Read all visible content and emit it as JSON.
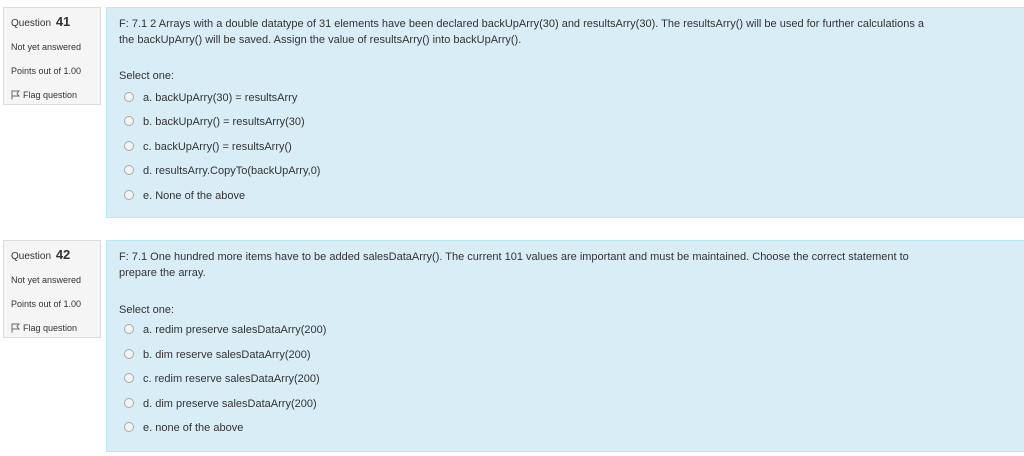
{
  "questions": [
    {
      "number_prefix": "Question",
      "number": "41",
      "state": "Not yet answered",
      "grade": "Points out of 1.00",
      "flag_label": "Flag question",
      "text_line1": "F: 7.1 2 Arrays with a double datatype of 31 elements have been declared backUpArry(30) and resultsArry(30). The resultsArry() will be used for further calculations a",
      "text_line2": "the backUpArry() will be saved. Assign the value of resultsArry() into backUpArry().",
      "prompt": "Select one:",
      "options": [
        "a. backUpArry(30) = resultsArry",
        "b. backUpArry() = resultsArry(30)",
        "c. backUpArry() = resultsArry()",
        "d. resultsArry.CopyTo(backUpArry,0)",
        "e. None of the above"
      ]
    },
    {
      "number_prefix": "Question",
      "number": "42",
      "state": "Not yet answered",
      "grade": "Points out of 1.00",
      "flag_label": "Flag question",
      "text_line1": "F: 7.1 One hundred more items have to be added salesDataArry(). The current 101 values are important and must be maintained. Choose the correct statement to",
      "text_line2": "prepare the array.",
      "prompt": "Select one:",
      "options": [
        "a. redim preserve salesDataArry(200)",
        "b. dim reserve salesDataArry(200)",
        "c. redim reserve salesDataArry(200)",
        "d. dim preserve salesDataArry(200)",
        "e. none of the above"
      ]
    }
  ]
}
